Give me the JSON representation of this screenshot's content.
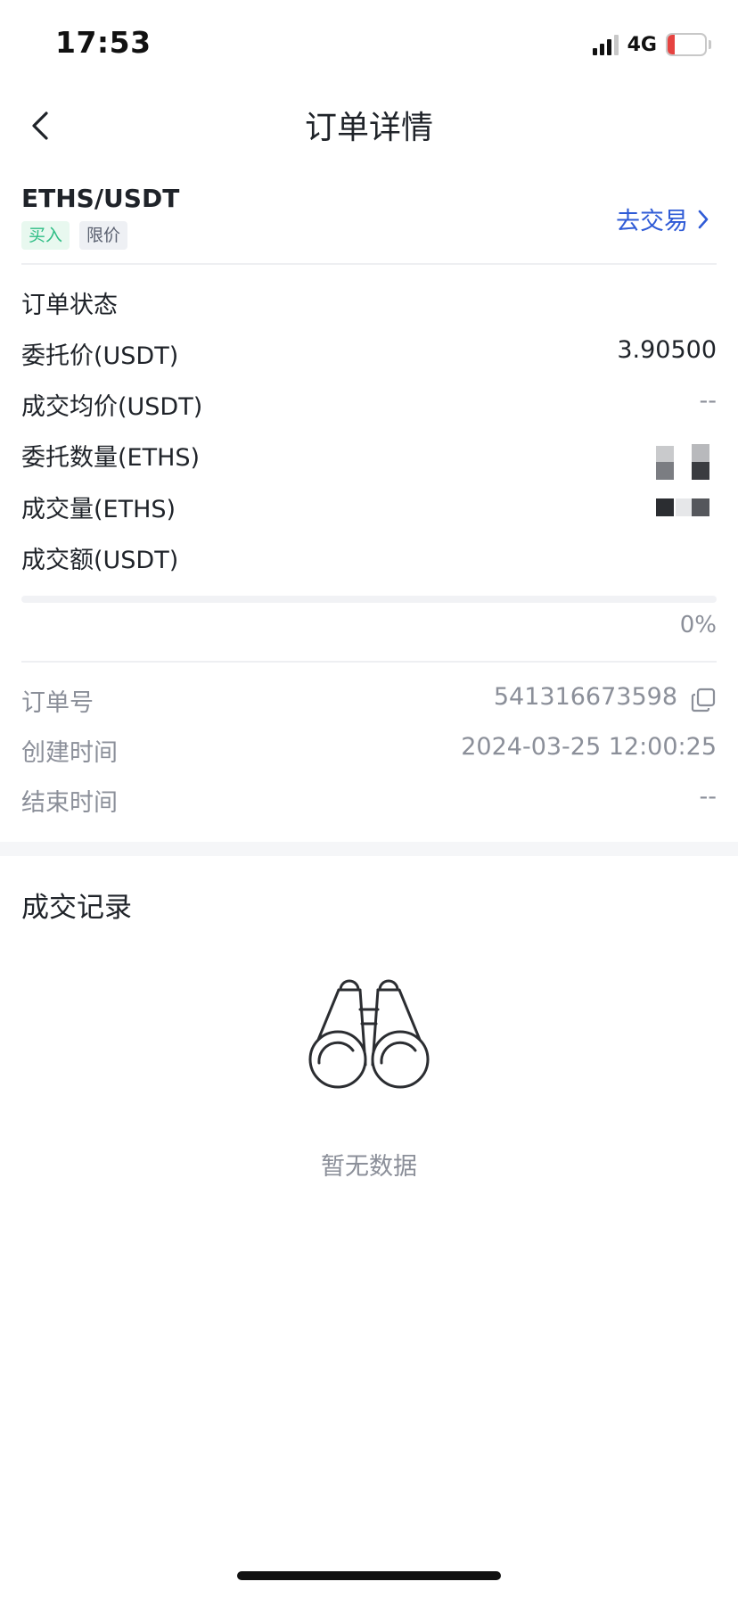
{
  "status_bar": {
    "time": "17:53",
    "network": "4G",
    "battery": "19",
    "battery_level": 0.19
  },
  "header": {
    "title": "订单详情"
  },
  "pair": {
    "name": "ETHS/USDT",
    "side_tag": "买入",
    "type_tag": "限价",
    "go_trade": "去交易"
  },
  "details": {
    "status_label": "订单状态",
    "entrust_price_label": "委托价(USDT)",
    "entrust_price_value": "3.90500",
    "avg_price_label": "成交均价(USDT)",
    "avg_price_value": "--",
    "entrust_qty_label": "委托数量(ETHS)",
    "filled_qty_label": "成交量(ETHS)",
    "filled_amount_label": "成交额(USDT)"
  },
  "progress": {
    "text": "0%",
    "value": 0
  },
  "meta": {
    "order_id_label": "订单号",
    "order_id_value": "541316673598",
    "create_time_label": "创建时间",
    "create_time_value": "2024-03-25 12:00:25",
    "end_time_label": "结束时间",
    "end_time_value": "--"
  },
  "records": {
    "title": "成交记录",
    "empty_text": "暂无数据"
  },
  "colors": {
    "accent": "#2f5bd6",
    "buy": "#2ebd85",
    "muted": "#8b8f99",
    "battery_low": "#e64340"
  }
}
